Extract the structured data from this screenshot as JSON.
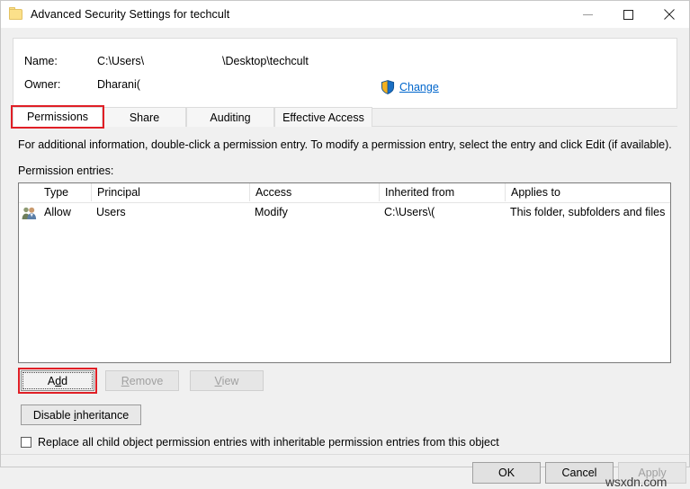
{
  "window": {
    "title": "Advanced Security Settings for techcult",
    "icon": "folder-icon",
    "minimize_label": "Minimize",
    "maximize_label": "Maximize",
    "close_label": "Close"
  },
  "header": {
    "name_label": "Name:",
    "name_value_part1": "C:\\Users\\",
    "name_value_part2": "\\Desktop\\techcult",
    "owner_label": "Owner:",
    "owner_value": "Dharani(",
    "change_link": "Change",
    "change_icon": "uac-shield-icon"
  },
  "tabs": [
    {
      "label": "Permissions",
      "selected": true
    },
    {
      "label": "Share",
      "selected": false
    },
    {
      "label": "Auditing",
      "selected": false
    },
    {
      "label": "Effective Access",
      "selected": false
    }
  ],
  "main": {
    "info_text": "For additional information, double-click a permission entry. To modify a permission entry, select the entry and click Edit (if available).",
    "entries_label": "Permission entries:"
  },
  "table": {
    "columns": [
      "Type",
      "Principal",
      "Access",
      "Inherited from",
      "Applies to"
    ],
    "rows": [
      {
        "icon": "users-group-icon",
        "type": "Allow",
        "principal": "Users",
        "access": "Modify",
        "inherited_from": "C:\\Users\\(",
        "applies_to": "This folder, subfolders and files"
      }
    ]
  },
  "buttons": {
    "add": {
      "label": "Add",
      "accel": "d",
      "enabled": true,
      "focused": true
    },
    "remove": {
      "label": "Remove",
      "accel": "R",
      "enabled": false
    },
    "view": {
      "label": "View",
      "accel": "V",
      "enabled": false
    },
    "disable_inheritance": {
      "label": "Disable inheritance",
      "accel": "i",
      "enabled": true
    }
  },
  "checkbox": {
    "label": "Replace all child object permission entries with inheritable permission entries from this object",
    "accel": "p",
    "checked": false
  },
  "footer": {
    "ok": "OK",
    "cancel": "Cancel",
    "apply": "Apply",
    "apply_enabled": false
  },
  "watermark": "wsxdn.com",
  "colors": {
    "highlight_red": "#e01f26",
    "link_blue": "#0066cc",
    "dialog_bg": "#f0f0f0",
    "panel_bg": "#ffffff"
  }
}
